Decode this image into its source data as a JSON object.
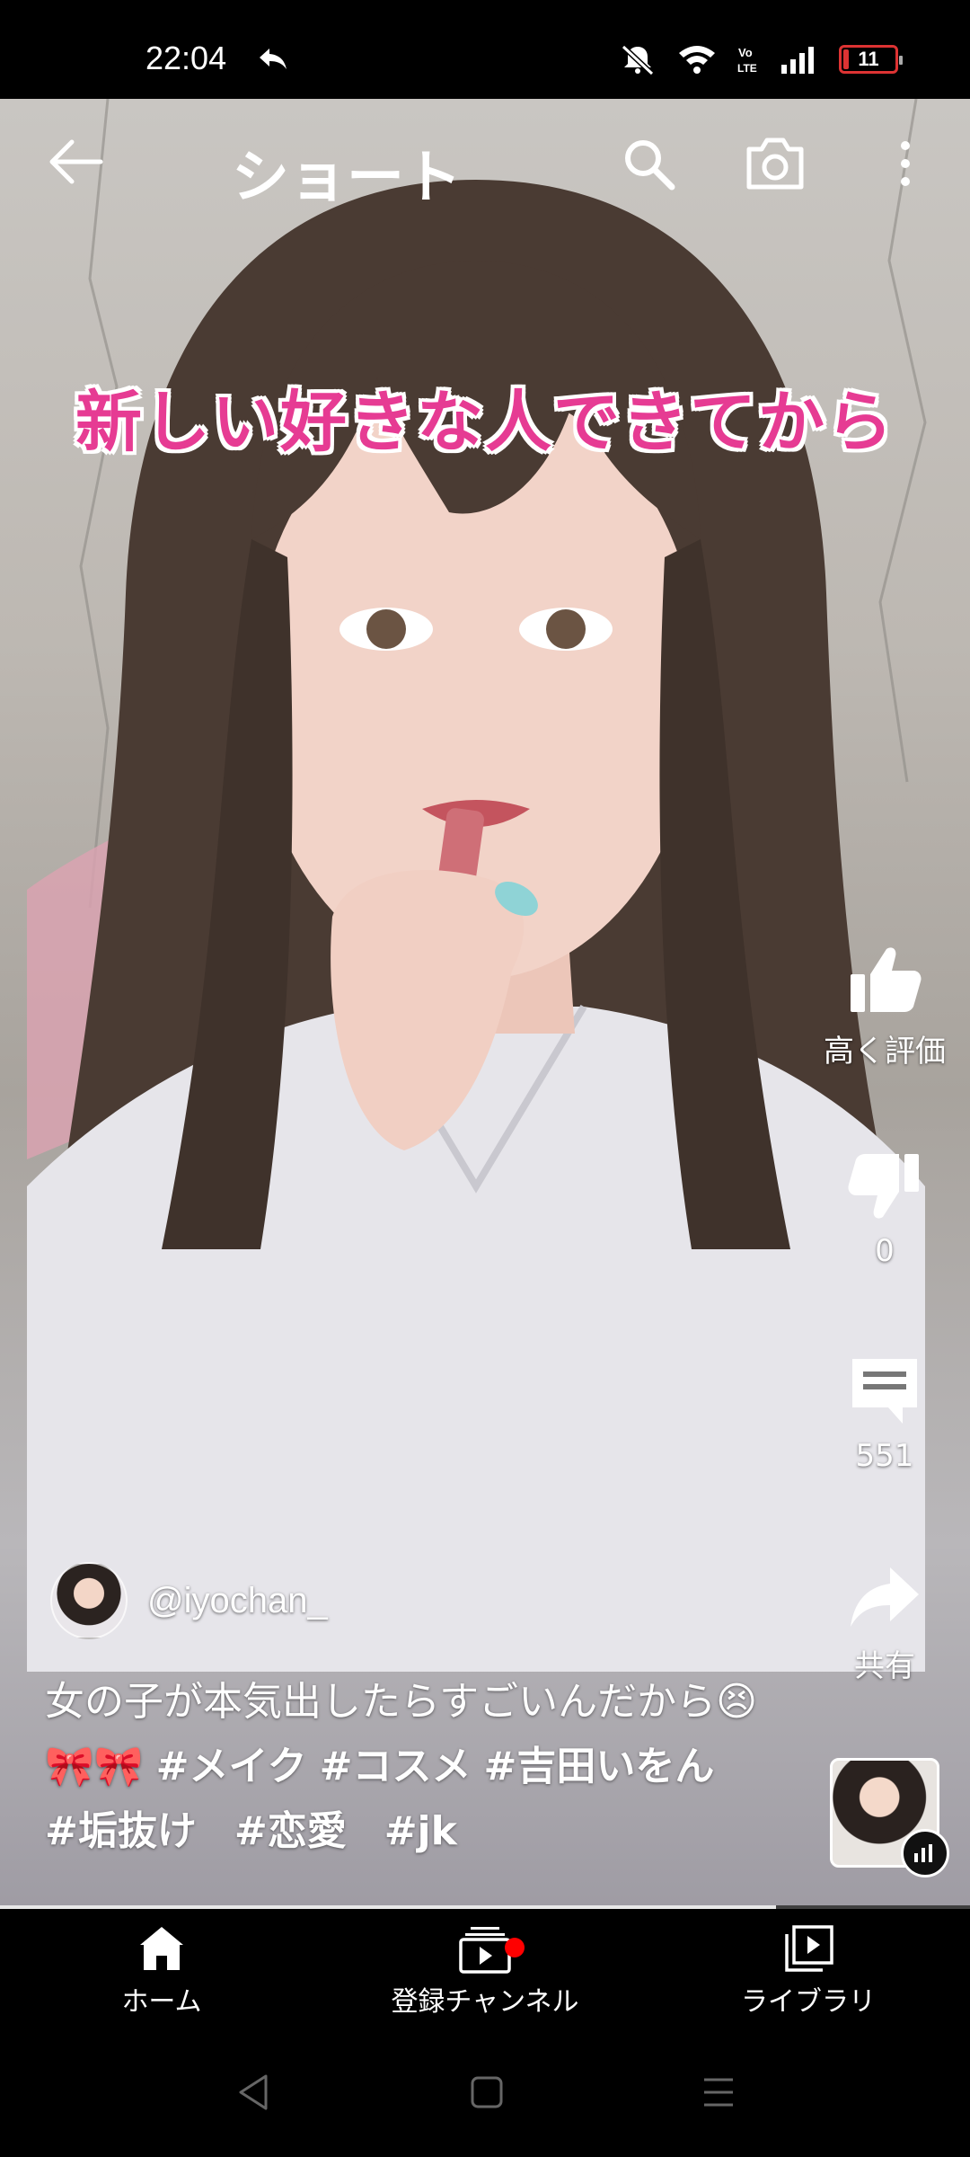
{
  "status_bar": {
    "time": "22:04",
    "battery_level": "11",
    "battery_fraction": 0.11,
    "icons": [
      "reply-icon",
      "mute-icon",
      "wifi-icon",
      "volte-icon",
      "signal-icon",
      "battery-icon"
    ]
  },
  "topbar": {
    "title": "ショート",
    "icons": [
      "back-arrow-icon",
      "search-icon",
      "camera-icon",
      "more-vert-icon"
    ]
  },
  "video": {
    "overlay_caption": "新しい好きな人できてから",
    "progress_fraction": 0.8
  },
  "actions": {
    "like_label": "高く評価",
    "dislike_count": "0",
    "comment_count": "551",
    "share_label": "共有"
  },
  "channel": {
    "handle": "@iyochan_"
  },
  "description": {
    "text": "女の子が本気出したらすごいんだから😣🎀🎀",
    "tags": [
      "#メイク",
      "#コスメ",
      "#吉田いをん",
      "#垢抜け",
      "#恋愛",
      "#jk"
    ]
  },
  "bottom_nav": {
    "home_label": "ホーム",
    "subscriptions_label": "登録チャンネル",
    "library_label": "ライブラリ"
  },
  "colors": {
    "caption_pink": "#e63b93",
    "notification_red": "#ff0000",
    "battery_red": "#dd3333"
  }
}
